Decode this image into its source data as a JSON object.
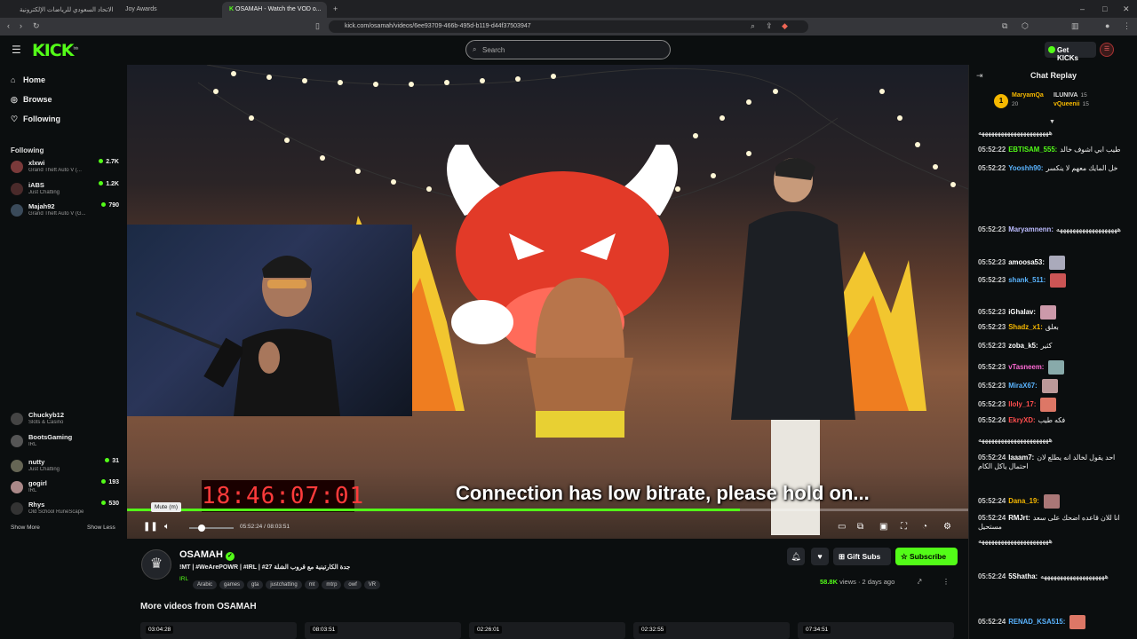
{
  "browser": {
    "tabs": [
      {
        "label": "جوائز الاتحاد السعودي للرياضات الإلكترونية"
      },
      {
        "label": "Joy Awards"
      },
      {
        "label": "OSAMAH - Watch the VOD o..."
      }
    ],
    "url": "kick.com/osamah/videos/6ee93709-466b-495d-b119-d44f37503947"
  },
  "header": {
    "logo": "KICK",
    "logo_beta": "beta",
    "search_placeholder": "Search",
    "get_kicks": "Get KICKs"
  },
  "sidebar": {
    "nav": [
      {
        "label": "Home",
        "icon": "home-icon"
      },
      {
        "label": "Browse",
        "icon": "compass-icon"
      },
      {
        "label": "Following",
        "icon": "heart-icon"
      }
    ],
    "following_title": "Following",
    "following": [
      {
        "name": "xlxwi",
        "game": "Grand Theft Auto V (...",
        "count": "2.7K"
      },
      {
        "name": "iABS",
        "game": "Just Chatting",
        "count": "1.2K"
      },
      {
        "name": "Majah92",
        "game": "Grand Theft Auto V (G...",
        "count": "790"
      },
      {
        "name": "Chuckyb12",
        "game": "Slots & Casino",
        "count": ""
      },
      {
        "name": "BootsGaming",
        "game": "IRL",
        "count": ""
      },
      {
        "name": "nutty",
        "game": "Just Chatting",
        "count": "31"
      },
      {
        "name": "gogirl",
        "game": "IRL",
        "count": "193"
      },
      {
        "name": "Rhys",
        "game": "Old School RuneScape",
        "count": "530"
      }
    ],
    "show_more": "Show More",
    "show_less": "Show Less"
  },
  "video": {
    "overlay_clock": "18:46:07:01",
    "low_bitrate": "Connection has low bitrate, please hold on...",
    "tooltip": "Mute (m)",
    "time_current": "05:52:24",
    "time_total": "08:03:51",
    "progress": 0.729
  },
  "channel": {
    "name": "OSAMAH",
    "title": "!MT | #WeArePOWR | #IRL | #27 جدة الكارتينية مع قروب الشلة",
    "category": "IRL",
    "tags": [
      "Arabic",
      "games",
      "gta",
      "justchatting",
      "mt",
      "mtrp",
      "owf",
      "VR"
    ],
    "gift_subs": "Gift Subs",
    "subscribe": "Subscribe",
    "views": "58.8K",
    "views_label": "views",
    "ago": "2 days ago",
    "more_videos": "More videos from OSAMAH",
    "thumbs": [
      "03:04:28",
      "08:03:51",
      "02:26:01",
      "02:32:55",
      "07:34:51"
    ]
  },
  "chat": {
    "title": "Chat Replay",
    "gifters": [
      {
        "name": "MaryamQa",
        "count": "20"
      },
      {
        "name": "ILUNIVA",
        "count": "15"
      },
      {
        "name": "vQueenii",
        "count": "15"
      }
    ],
    "messages": [
      {
        "time": "",
        "user": "",
        "color": "#ffffff",
        "text": "ههههههههههههههههههههههه"
      },
      {
        "time": "05:52:22",
        "user": "EBTISAM_555:",
        "color": "#53fc18",
        "text": "طيب ابي اشوف خالد"
      },
      {
        "time": "05:52:22",
        "user": "Yooshh90:",
        "color": "#5ab4ff",
        "text": "خل المايك معهم لا ينكسر"
      },
      {
        "time": "05:52:23",
        "user": "Maryamnenn:",
        "color": "#bcbcff",
        "text": "هههههههههههههههههههه"
      },
      {
        "time": "05:52:23",
        "user": "amoosa53:",
        "color": "#ffffff",
        "text": ""
      },
      {
        "time": "05:52:23",
        "user": "shank_511:",
        "color": "#5ab4ff",
        "text": ""
      },
      {
        "time": "05:52:23",
        "user": "iGhalav:",
        "color": "#ffffff",
        "text": ""
      },
      {
        "time": "05:52:23",
        "user": "Shadz_x1:",
        "color": "#f6b800",
        "text": "بعلق"
      },
      {
        "time": "05:52:23",
        "user": "zoba_k5:",
        "color": "#ffffff",
        "text": "كثير"
      },
      {
        "time": "05:52:23",
        "user": "vTasneem:",
        "color": "#ff6ad5",
        "text": ""
      },
      {
        "time": "05:52:23",
        "user": "MiraX67:",
        "color": "#5ab4ff",
        "text": ""
      },
      {
        "time": "05:52:23",
        "user": "lloly_17:",
        "color": "#ff4d4d",
        "text": ""
      },
      {
        "time": "05:52:24",
        "user": "EkryXD:",
        "color": "#ff4d4d",
        "text": "فكه طيب"
      },
      {
        "time": "",
        "user": "",
        "color": "#ffffff",
        "text": "ههههههههههههههههههههههه"
      },
      {
        "time": "05:52:24",
        "user": "laaam7:",
        "color": "#ffffff",
        "text": "احد يقول لخالد انه يطلع لان احتمال ياكل الكام"
      },
      {
        "time": "05:52:24",
        "user": "Dana_19:",
        "color": "#f6b800",
        "text": ""
      },
      {
        "time": "05:52:24",
        "user": "RMJrt:",
        "color": "#ffffff",
        "text": "انا للان قاعده اضحك على سعد مستحيل"
      },
      {
        "time": "",
        "user": "",
        "color": "#ffffff",
        "text": "ههههههههههههههههههههههه"
      },
      {
        "time": "05:52:24",
        "user": "5Shatha:",
        "color": "#ffffff",
        "text": "ههههههههههههههههههههه"
      },
      {
        "time": "05:52:24",
        "user": "RENAD_KSA515:",
        "color": "#5ab4ff",
        "text": ""
      }
    ]
  }
}
